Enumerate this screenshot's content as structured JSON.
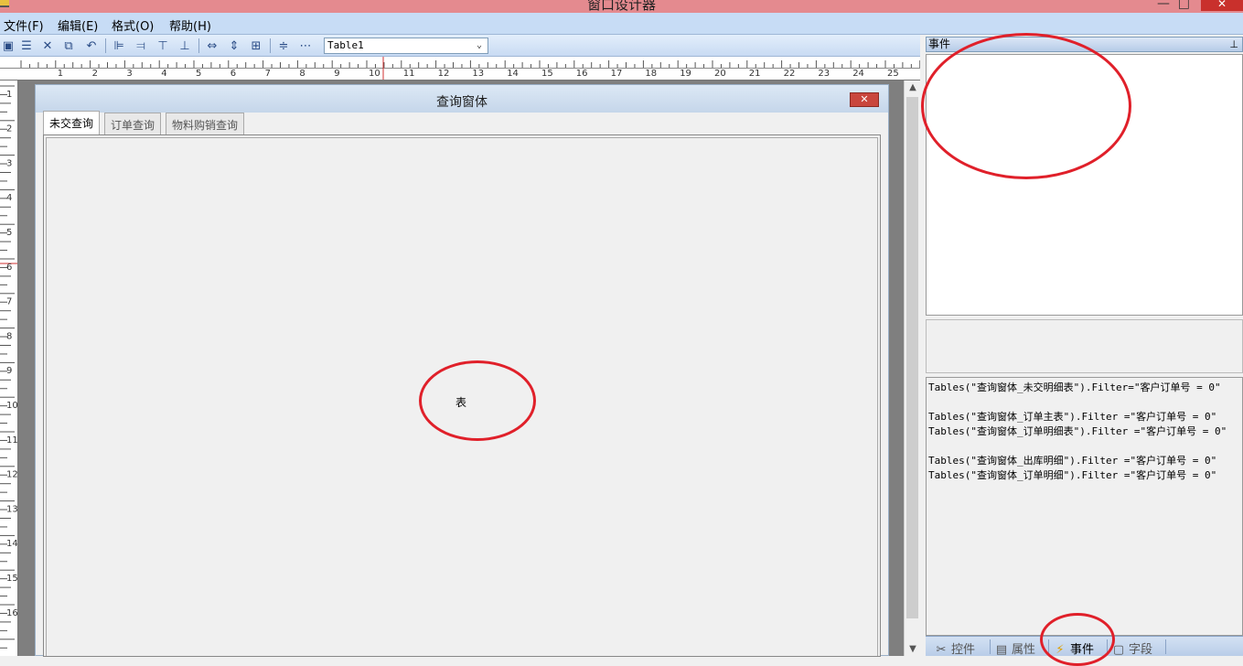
{
  "window": {
    "title": "窗口设计器",
    "minimize": "—",
    "maximize": "□",
    "close": "✕"
  },
  "menu": [
    {
      "label": "文件(F)",
      "name": "menu-file"
    },
    {
      "label": "编辑(E)",
      "name": "menu-edit"
    },
    {
      "label": "格式(O)",
      "name": "menu-format"
    },
    {
      "label": "帮助(H)",
      "name": "menu-help"
    }
  ],
  "toolbar": {
    "icons": [
      "save-icon",
      "save-all-icon",
      "delete-icon",
      "copy-icon",
      "undo-icon",
      "align-left-icon",
      "align-right-icon",
      "align-top-icon",
      "align-bottom-icon",
      "same-width-icon",
      "same-height-icon",
      "same-size-icon",
      "vertical-spacing-icon",
      "horizontal-spacing-icon"
    ],
    "control_select": "Table1"
  },
  "ruler": {
    "h_numbers": [
      "1",
      "2",
      "3",
      "4",
      "5",
      "6",
      "7",
      "8",
      "9",
      "10",
      "11",
      "12",
      "13",
      "14",
      "15",
      "16",
      "17",
      "18",
      "19",
      "20",
      "21",
      "22",
      "23",
      "24",
      "25"
    ],
    "v_numbers": [
      "1",
      "2",
      "3",
      "4",
      "5",
      "6",
      "7",
      "8",
      "9",
      "10",
      "11",
      "12",
      "13",
      "14",
      "15",
      "16"
    ]
  },
  "form": {
    "title": "查询窗体",
    "close": "✕",
    "tabs": [
      "未交查询",
      "订单查询",
      "物料购销查询"
    ],
    "active_tab": 0,
    "table_label": "表"
  },
  "right_panel": {
    "header": "事件",
    "pin": "⊥",
    "code_lines": [
      "Tables(\"查询窗体_未交明细表\").Filter=\"客户订单号 = 0\"",
      "",
      "Tables(\"查询窗体_订单主表\").Filter =\"客户订单号 = 0\"",
      "Tables(\"查询窗体_订单明细表\").Filter =\"客户订单号 = 0\"",
      "",
      "Tables(\"查询窗体_出库明细\").Filter =\"客户订单号 = 0\"",
      "Tables(\"查询窗体_订单明细\").Filter =\"客户订单号 = 0\""
    ],
    "bottom_tabs": [
      {
        "label": "控件",
        "icon": "tools-icon",
        "glyph": "✂"
      },
      {
        "label": "属性",
        "icon": "properties-icon",
        "glyph": "▤"
      },
      {
        "label": "事件",
        "icon": "lightning-icon",
        "glyph": "⚡"
      },
      {
        "label": "字段",
        "icon": "field-icon",
        "glyph": "▢"
      }
    ],
    "active_bottom_tab": 2
  },
  "colors": {
    "annotation": "#e0202a",
    "titlebar": "#e48a8f",
    "menubar": "#c7dcf5"
  }
}
